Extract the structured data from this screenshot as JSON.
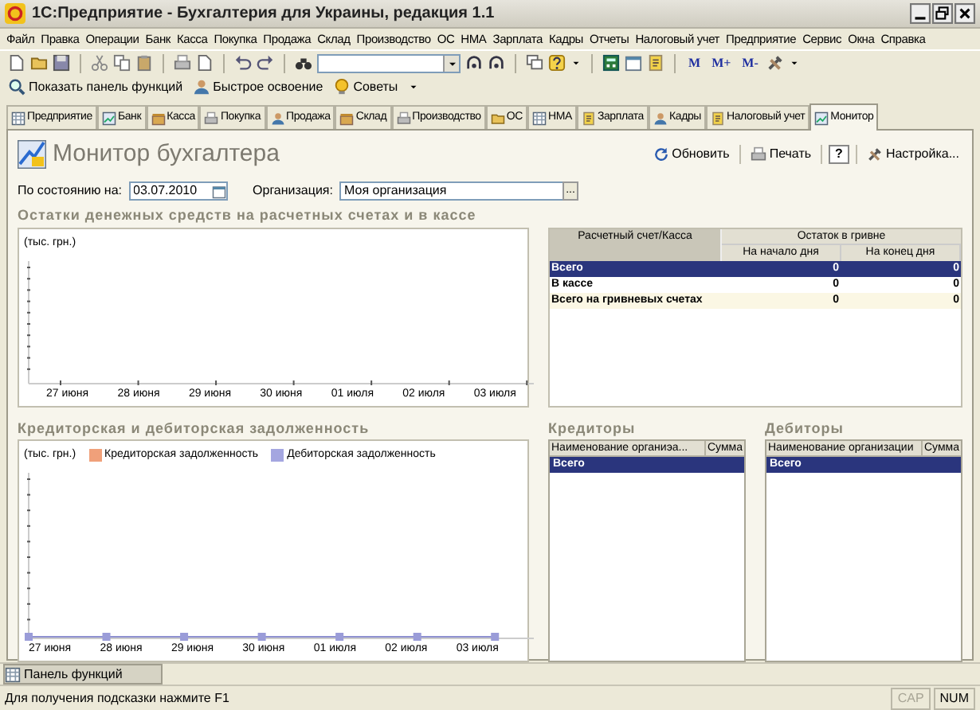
{
  "window": {
    "title": "1С:Предприятие - Бухгалтерия для Украины, редакция 1.1"
  },
  "menu": [
    "Файл",
    "Правка",
    "Операции",
    "Банк",
    "Касса",
    "Покупка",
    "Продажа",
    "Склад",
    "Производство",
    "ОС",
    "НМА",
    "Зарплата",
    "Кадры",
    "Отчеты",
    "Налоговый учет",
    "Предприятие",
    "Сервис",
    "Окна",
    "Справка"
  ],
  "toolbar": {
    "memory_buttons": [
      "M",
      "M+",
      "M-"
    ]
  },
  "quick_bar": [
    "Показать панель функций",
    "Быстрое освоение",
    "Советы"
  ],
  "tabs": [
    {
      "label": "Предприятие",
      "selected": false
    },
    {
      "label": "Банк",
      "selected": false
    },
    {
      "label": "Касса",
      "selected": false
    },
    {
      "label": "Покупка",
      "selected": false
    },
    {
      "label": "Продажа",
      "selected": false
    },
    {
      "label": "Склад",
      "selected": false
    },
    {
      "label": "Производство",
      "selected": false
    },
    {
      "label": "ОС",
      "selected": false
    },
    {
      "label": "НМА",
      "selected": false
    },
    {
      "label": "Зарплата",
      "selected": false
    },
    {
      "label": "Кадры",
      "selected": false
    },
    {
      "label": "Налоговый учет",
      "selected": false
    },
    {
      "label": "Монитор",
      "selected": true
    }
  ],
  "form": {
    "title": "Монитор бухгалтера",
    "actions": [
      "Обновить",
      "Печать",
      "?",
      "Настройка..."
    ],
    "date_label": "По состоянию на:",
    "date_value": "03.07.2010",
    "org_label": "Организация:",
    "org_value": "Моя организация",
    "org_button": "..."
  },
  "cash": {
    "title": "Остатки денежных средств на расчетных счетах и в кассе",
    "chart": {
      "unit": "(тыс. грн.)",
      "x_labels": [
        "27 июня",
        "28 июня",
        "29 июня",
        "30 июня",
        "01 июля",
        "02 июля",
        "03 июля"
      ]
    },
    "table": {
      "column": "Расчетный счет/Касса",
      "group": "Остаток в гривне",
      "subcolumns": [
        "На начало дня",
        "На конец дня"
      ],
      "rows": [
        {
          "name": "Всего",
          "start": "0",
          "end": "0",
          "selected": true
        },
        {
          "name": "В кассе",
          "start": "0",
          "end": "0",
          "selected": false
        },
        {
          "name": "Всего на гривневых счетах",
          "start": "0",
          "end": "0",
          "selected": false
        }
      ]
    }
  },
  "debts": {
    "title": "Кредиторская и дебиторская задолженность",
    "chart": {
      "unit": "(тыс. грн.)",
      "legend": [
        {
          "label": "Кредиторская задолженность",
          "color": "#f0a07a"
        },
        {
          "label": "Дебиторская задолженность",
          "color": "#a4a6e0"
        }
      ],
      "x_labels": [
        "27 июня",
        "28 июня",
        "29 июня",
        "30 июня",
        "01 июля",
        "02 июля",
        "03 июля"
      ]
    }
  },
  "creditors": {
    "title": "Кредиторы",
    "columns": [
      "Наименование органиэа...",
      "Сумма"
    ],
    "rows": [
      {
        "name": "Всего",
        "selected": true
      }
    ]
  },
  "debtors": {
    "title": "Дебиторы",
    "columns": [
      "Наименование организации",
      "Сумма"
    ],
    "rows": [
      {
        "name": "Всего",
        "selected": true
      }
    ]
  },
  "taskbar": [
    {
      "label": "Панель функций"
    }
  ],
  "status_bar": {
    "hint": "Для получения подсказки нажмите F1",
    "indicators": [
      {
        "label": "CAP",
        "on": false
      },
      {
        "label": "NUM",
        "on": true
      }
    ]
  }
}
